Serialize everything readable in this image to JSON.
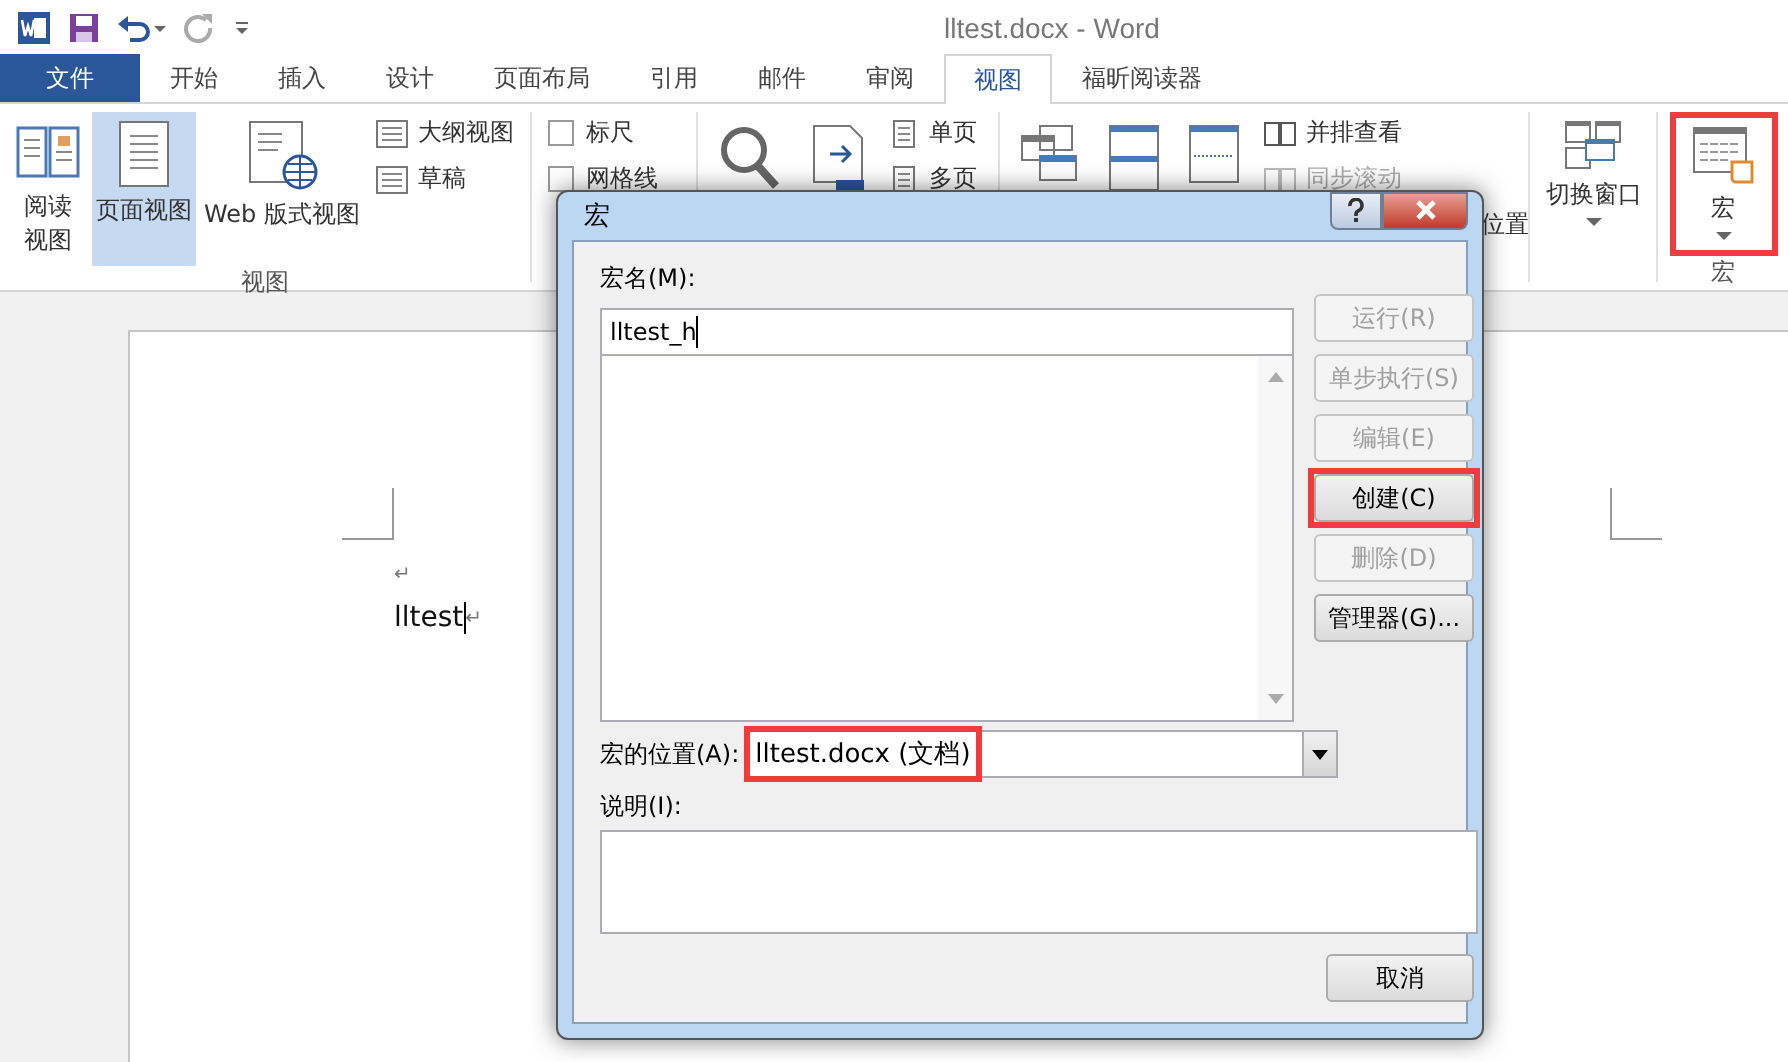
{
  "window": {
    "title": "lltest.docx - Word"
  },
  "tabs": [
    {
      "label": "文件",
      "kind": "file",
      "selected": false
    },
    {
      "label": "开始",
      "kind": "tab",
      "selected": false
    },
    {
      "label": "插入",
      "kind": "tab",
      "selected": false
    },
    {
      "label": "设计",
      "kind": "tab",
      "selected": false
    },
    {
      "label": "页面布局",
      "kind": "tab",
      "selected": false
    },
    {
      "label": "引用",
      "kind": "tab",
      "selected": false
    },
    {
      "label": "邮件",
      "kind": "tab",
      "selected": false
    },
    {
      "label": "审阅",
      "kind": "tab",
      "selected": false
    },
    {
      "label": "视图",
      "kind": "tab",
      "selected": true
    },
    {
      "label": "福昕阅读器",
      "kind": "tab",
      "selected": false
    }
  ],
  "view_group": {
    "label": "视图",
    "buttons": [
      {
        "label": "阅读视图",
        "kind": "read",
        "selected": false
      },
      {
        "label": "页面视图",
        "kind": "page",
        "selected": true
      },
      {
        "label": "Web 版式视图",
        "kind": "web",
        "selected": false
      }
    ],
    "small_buttons": [
      "大纲视图",
      "草稿"
    ]
  },
  "show_group": {
    "checkboxes": [
      {
        "label": "标尺",
        "checked": false
      },
      {
        "label": "网格线",
        "checked": false
      }
    ]
  },
  "zoom_group": {
    "small_buttons": [
      "单页",
      "多页"
    ]
  },
  "window_group": {
    "small_buttons": [
      {
        "label": "并排查看",
        "disabled": false
      },
      {
        "label": "同步滚动",
        "disabled": true
      }
    ],
    "partial_label": "位置",
    "switch_label": "切换窗口"
  },
  "macro_group": {
    "button_label": "宏",
    "label": "宏",
    "highlighted": true
  },
  "document": {
    "paragraphs": [
      {
        "mark": "↵"
      },
      {
        "text": "lltest",
        "mark": "↵"
      }
    ]
  },
  "dialog": {
    "title": "宏",
    "name_label": "宏名(M):",
    "name_value": "lltest_h",
    "buttons": [
      {
        "label": "运行(R)",
        "disabled": true,
        "highlighted": false
      },
      {
        "label": "单步执行(S)",
        "disabled": true,
        "highlighted": false
      },
      {
        "label": "编辑(E)",
        "disabled": true,
        "highlighted": false
      },
      {
        "label": "创建(C)",
        "disabled": false,
        "highlighted": true
      },
      {
        "label": "删除(D)",
        "disabled": true,
        "highlighted": false
      },
      {
        "label": "管理器(G)...",
        "disabled": false,
        "highlighted": false
      }
    ],
    "location_label": "宏的位置(A):",
    "location_value": "lltest.docx (文档)",
    "location_highlighted": true,
    "description_label": "说明(I):",
    "cancel_label": "取消"
  }
}
